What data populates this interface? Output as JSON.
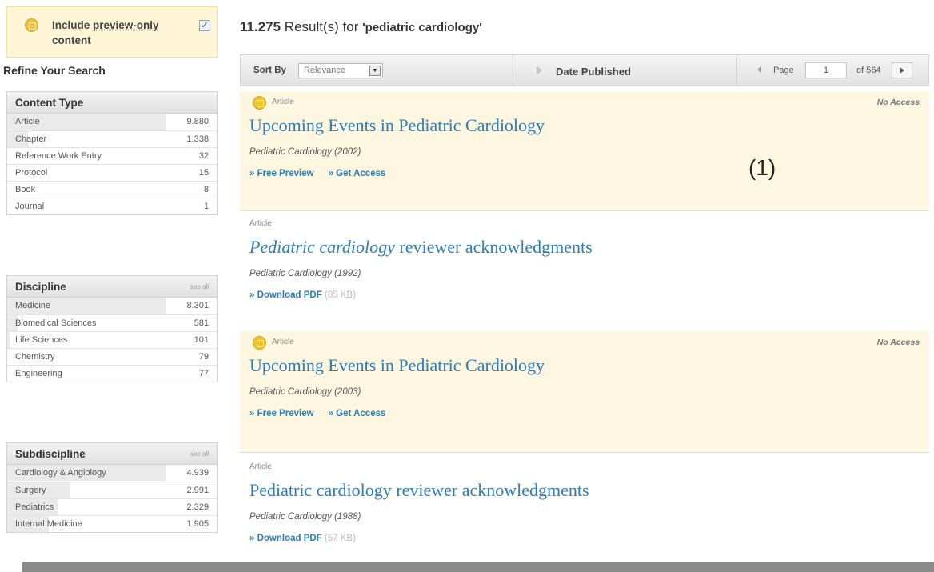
{
  "preview": {
    "label_pre": "Include ",
    "label_link": "preview-only",
    "label_post": " content",
    "checkbox_mark": "✓",
    "checked": true
  },
  "refine_title": "Refine Your Search",
  "facets": {
    "content_type": {
      "title": "Content Type",
      "items": [
        {
          "name": "Article",
          "count": "9.880",
          "fill": 0.76
        },
        {
          "name": "Chapter",
          "count": "1.338",
          "fill": 0.1
        },
        {
          "name": "Reference Work Entry",
          "count": "32",
          "fill": 0
        },
        {
          "name": "Protocol",
          "count": "15",
          "fill": 0
        },
        {
          "name": "Book",
          "count": "8",
          "fill": 0
        },
        {
          "name": "Journal",
          "count": "1",
          "fill": 0
        }
      ]
    },
    "discipline": {
      "title": "Discipline",
      "see_all": "see all",
      "items": [
        {
          "name": "Medicine",
          "count": "8.301",
          "fill": 0.76
        },
        {
          "name": "Biomedical Sciences",
          "count": "581",
          "fill": 0.05
        },
        {
          "name": "Life Sciences",
          "count": "101",
          "fill": 0.01
        },
        {
          "name": "Chemistry",
          "count": "79",
          "fill": 0
        },
        {
          "name": "Engineering",
          "count": "77",
          "fill": 0
        }
      ]
    },
    "subdiscipline": {
      "title": "Subdiscipline",
      "see_all": "see all",
      "items": [
        {
          "name": "Cardiology & Angiology",
          "count": "4.939",
          "fill": 0.76
        },
        {
          "name": "Surgery",
          "count": "2.991",
          "fill": 0.3
        },
        {
          "name": "Pediatrics",
          "count": "2.329",
          "fill": 0.24
        },
        {
          "name": "Internal Medicine",
          "count": "1.905",
          "fill": 0.2
        }
      ]
    }
  },
  "results_header": {
    "count": "11.275",
    "text": " Result(s) for ",
    "query": "'pediatric cardiology'"
  },
  "sortbar": {
    "sort_label": "Sort By",
    "sort_value": "Relevance",
    "date_label": "Date Published",
    "page_label": "Page",
    "page_value": "1",
    "of_label": "of 564"
  },
  "results": [
    {
      "type": "Article",
      "access": "No Access",
      "title": "Upcoming Events in Pediatric Cardiology",
      "journal": "Pediatric Cardiology (2002)",
      "link1": "» Free Preview",
      "link2": "» Get Access"
    },
    {
      "type": "Article",
      "title_em": "Pediatric cardiology",
      "title_rest": " reviewer acknowledgments",
      "journal": "Pediatric Cardiology (1992)",
      "link1": "» Download PDF",
      "size": " (85 KB)"
    },
    {
      "type": "Article",
      "access": "No Access",
      "title": "Upcoming Events in Pediatric Cardiology",
      "journal": "Pediatric Cardiology (2003)",
      "link1": "» Free Preview",
      "link2": "» Get Access"
    },
    {
      "type": "Article",
      "title": "Pediatric cardiology reviewer acknowledgments",
      "journal": "Pediatric Cardiology (1988)",
      "link1": "» Download PDF",
      "size": " (57 KB)"
    }
  ],
  "annotation": "(1)"
}
